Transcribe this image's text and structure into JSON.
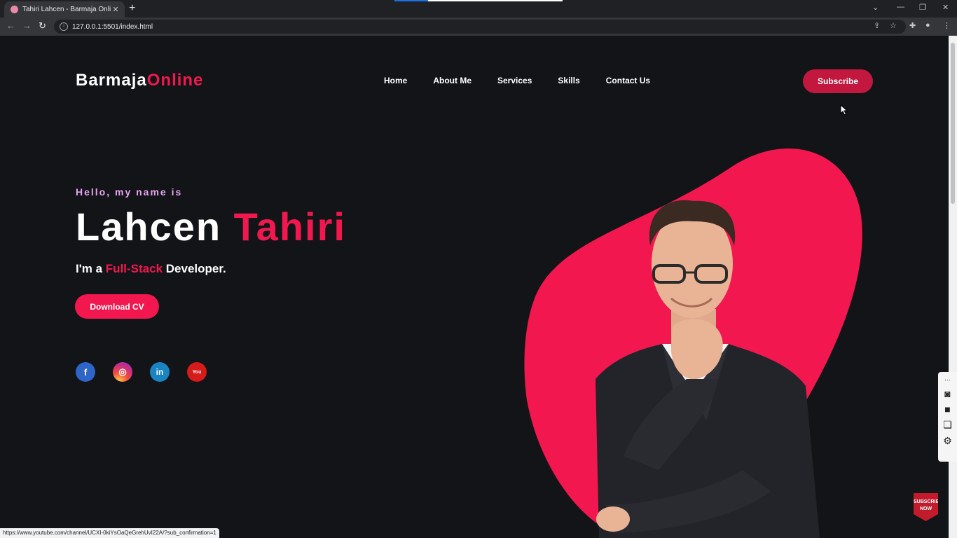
{
  "browser": {
    "tab_title": "Tahiri Lahcen - Barmaja Online",
    "tab_close": "✕",
    "new_tab": "+",
    "url": "127.0.0.1:5501/index.html",
    "status_url": "https://www.youtube.com/channel/UCXI-0kiYsOaQeGrehUvI22A/?sub_confirmation=1"
  },
  "header": {
    "logo_part1": "Barmaja",
    "logo_part2": "Online",
    "nav": [
      "Home",
      "About Me",
      "Services",
      "Skills",
      "Contact Us"
    ],
    "subscribe_label": "Subscribe"
  },
  "hero": {
    "greeting": "Hello, my name is",
    "first_name": "Lahcen",
    "last_name": "Tahiri",
    "role_prefix": "I'm a ",
    "role_highlight": "Full-Stack",
    "role_suffix": " Developer.",
    "download_label": "Download CV"
  },
  "social": [
    {
      "icon": "facebook-icon",
      "glyph": "f"
    },
    {
      "icon": "instagram-icon",
      "glyph": "◎"
    },
    {
      "icon": "linkedin-icon",
      "glyph": "in"
    },
    {
      "icon": "youtube-icon",
      "glyph": "You"
    }
  ],
  "overlay": {
    "subscribe_now": "SUBSCRIBE NOW"
  },
  "colors": {
    "accent": "#f2184f",
    "subscribe_bg": "#c2173f",
    "greeting": "#e7a4f2",
    "background": "#121417"
  }
}
